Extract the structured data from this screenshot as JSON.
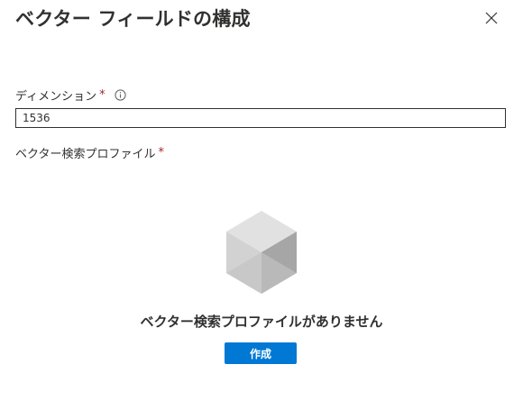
{
  "panel": {
    "title": "ベクター フィールドの構成",
    "close_icon": "close-icon"
  },
  "dimensions": {
    "label": "ディメンション",
    "required_mark": "*",
    "info_icon": "info-icon",
    "value": "1536"
  },
  "profile": {
    "label": "ベクター検索プロファイル",
    "required_mark": "*",
    "empty_icon": "cube-icon",
    "empty_message": "ベクター検索プロファイルがありません",
    "create_label": "作成"
  },
  "colors": {
    "accent": "#0078d4",
    "text": "#323130",
    "required": "#a4262c"
  }
}
